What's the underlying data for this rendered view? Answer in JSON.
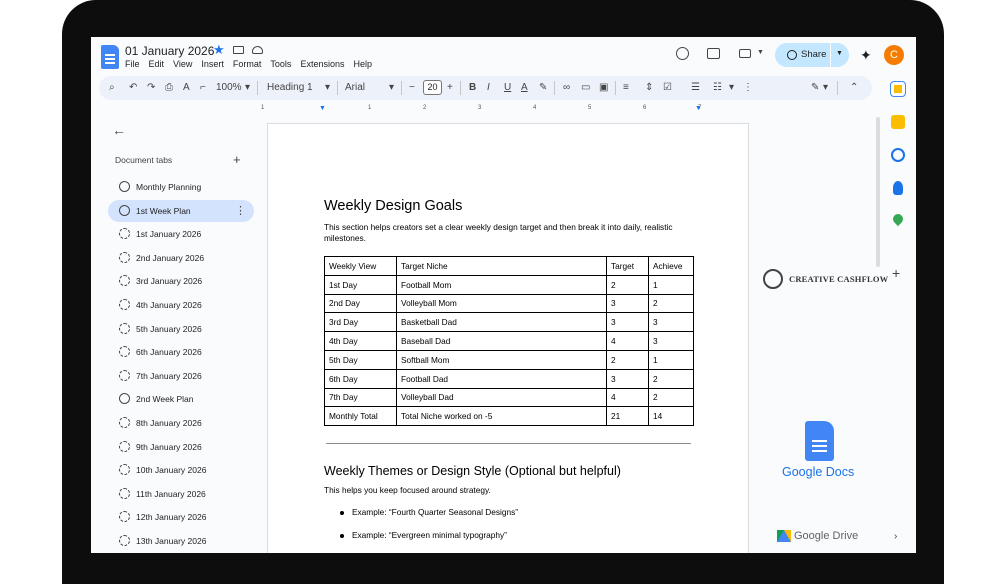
{
  "app": {
    "doc_title": "01 January 2026",
    "menu": [
      "File",
      "Edit",
      "View",
      "Insert",
      "Format",
      "Tools",
      "Extensions",
      "Help"
    ],
    "share_label": "Share",
    "avatar_letter": "C"
  },
  "toolbar": {
    "zoom": "100%",
    "style": "Heading 1",
    "font": "Arial",
    "font_size": "20",
    "minus": "−",
    "plus": "+"
  },
  "ruler": {
    "marks": [
      "1",
      "1",
      "2",
      "3",
      "4",
      "5",
      "6",
      "7"
    ]
  },
  "sidebar": {
    "header": "Document tabs",
    "tabs": [
      {
        "label": "Monthly Planning",
        "icon": "tab-icon",
        "sub": false,
        "selected": false
      },
      {
        "label": "1st Week Plan",
        "icon": "tab-icon",
        "sub": false,
        "selected": true
      },
      {
        "label": "1st January 2026",
        "icon": "subtab-icon",
        "sub": true,
        "selected": false
      },
      {
        "label": "2nd January 2026",
        "icon": "subtab-icon",
        "sub": true,
        "selected": false
      },
      {
        "label": "3rd January 2026",
        "icon": "subtab-icon",
        "sub": true,
        "selected": false
      },
      {
        "label": "4th January 2026",
        "icon": "subtab-icon",
        "sub": true,
        "selected": false
      },
      {
        "label": "5th January 2026",
        "icon": "subtab-icon",
        "sub": true,
        "selected": false
      },
      {
        "label": "6th January 2026",
        "icon": "subtab-icon",
        "sub": true,
        "selected": false
      },
      {
        "label": "7th January 2026",
        "icon": "subtab-icon",
        "sub": true,
        "selected": false
      },
      {
        "label": "2nd Week Plan",
        "icon": "tab-icon",
        "sub": false,
        "selected": false
      },
      {
        "label": "8th January 2026",
        "icon": "subtab-icon",
        "sub": true,
        "selected": false
      },
      {
        "label": "9th January 2026",
        "icon": "subtab-icon",
        "sub": true,
        "selected": false
      },
      {
        "label": "10th January 2026",
        "icon": "subtab-icon",
        "sub": true,
        "selected": false
      },
      {
        "label": "11th January 2026",
        "icon": "subtab-icon",
        "sub": true,
        "selected": false
      },
      {
        "label": "12th January 2026",
        "icon": "subtab-icon",
        "sub": true,
        "selected": false
      },
      {
        "label": "13th January 2026",
        "icon": "subtab-icon",
        "sub": true,
        "selected": false
      }
    ]
  },
  "document": {
    "heading": "Weekly Design Goals",
    "intro": "This section helps creators set a clear weekly design target and then break it into daily, realistic milestones.",
    "table": {
      "headers": [
        "Weekly View",
        "Target Niche",
        "Target",
        "Achieve"
      ],
      "rows": [
        [
          "1st Day",
          "Football Mom",
          "2",
          "1"
        ],
        [
          "2nd Day",
          "Volleyball Mom",
          "3",
          "2"
        ],
        [
          "3rd Day",
          "Basketball Dad",
          "3",
          "3"
        ],
        [
          "4th Day",
          "Baseball Dad",
          "4",
          "3"
        ],
        [
          "5th Day",
          "Softball Mom",
          "2",
          "1"
        ],
        [
          "6th Day",
          "Football Dad",
          "3",
          "2"
        ],
        [
          "7th Day",
          "Volleyball Dad",
          "4",
          "2"
        ],
        [
          "Monthly Total",
          "Total Niche worked on -5",
          "21",
          "14"
        ]
      ]
    },
    "heading2": "Weekly Themes or Design Style (Optional but helpful)",
    "para2": "This helps you keep focused around strategy.",
    "bullets": [
      "Example: “Fourth Quarter Seasonal Designs”",
      "Example: “Evergreen minimal typography”"
    ]
  },
  "branding": {
    "creative_cashflow": "CREATIVE CASHFLOW",
    "google_docs": "Google Docs",
    "google_drive": "Google Drive"
  },
  "colors": {
    "accent": "#1a73e8",
    "selected_tab": "#d3e3fd",
    "share_bg": "#c2e7ff",
    "avatar": "#f57c00"
  }
}
